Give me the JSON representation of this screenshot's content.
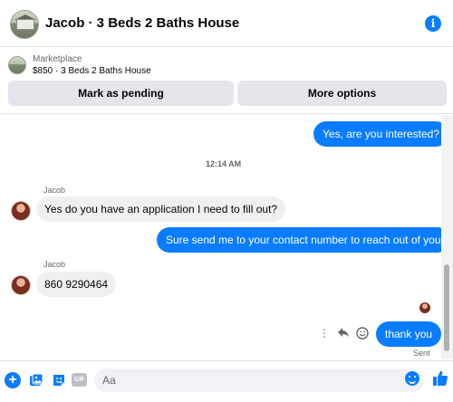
{
  "header": {
    "title": "Jacob · 3 Beds 2 Baths House",
    "info_icon": "info-icon"
  },
  "listing": {
    "label": "Marketplace",
    "price_line": "$850 · 3 Beds 2 Baths House",
    "mark_pending_label": "Mark as pending",
    "more_options_label": "More options"
  },
  "conversation": {
    "messages": [
      {
        "from": "me",
        "text": "Yes, are you interested?"
      },
      {
        "timestamp": "12:14 AM"
      },
      {
        "from": "Jacob",
        "sender": "Jacob",
        "text": "Yes do you have an application I need to fill out?"
      },
      {
        "from": "me",
        "text": "Sure send me to your contact number to reach out of you"
      },
      {
        "from": "Jacob",
        "sender": "Jacob",
        "text": "860 9290464"
      },
      {
        "from": "me",
        "text": "thank you",
        "status": "Sent"
      }
    ]
  },
  "message_actions": [
    "more-icon",
    "reply-icon",
    "react-icon"
  ],
  "composer": {
    "placeholder": "Aa",
    "gif_label": "GIF",
    "plus_label": "+",
    "icons": [
      "plus-icon",
      "photo-icon",
      "sticker-icon",
      "gif-icon",
      "emoji-icon",
      "thumbs-up-icon"
    ]
  },
  "colors": {
    "accent": "#0a7cff",
    "incoming_bubble": "#f0f0f0",
    "button_bg": "#e4e6eb",
    "secondary_text": "#65676b"
  }
}
